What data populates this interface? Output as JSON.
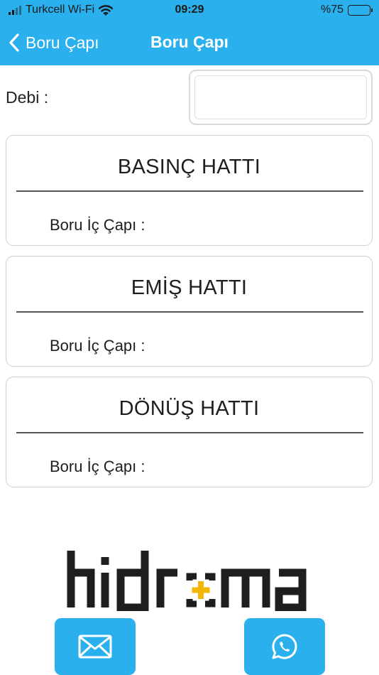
{
  "status_bar": {
    "carrier": "Turkcell Wi-Fi",
    "time": "09:29",
    "battery_text": "%75",
    "battery_level": 0.75
  },
  "nav": {
    "back_label": "Boru Çapı",
    "title": "Boru Çapı"
  },
  "form": {
    "debi_label": "Debi :",
    "debi_value": "",
    "debi_placeholder": ""
  },
  "sections": [
    {
      "title": "BASINÇ HATTI",
      "field_label": "Boru İç Çapı :"
    },
    {
      "title": "EMİŞ HATTI",
      "field_label": "Boru İç Çapı :"
    },
    {
      "title": "DÖNÜŞ HATTI",
      "field_label": "Boru İç Çapı :"
    }
  ],
  "logo": {
    "text": "hidroman",
    "text_color": "#1e1e1e",
    "accent_color": "#f2b705"
  },
  "actions": {
    "email_icon": "mail-icon",
    "whatsapp_icon": "whatsapp-icon"
  },
  "colors": {
    "accent": "#2ab0ec",
    "card_border": "#cfcfcf"
  }
}
